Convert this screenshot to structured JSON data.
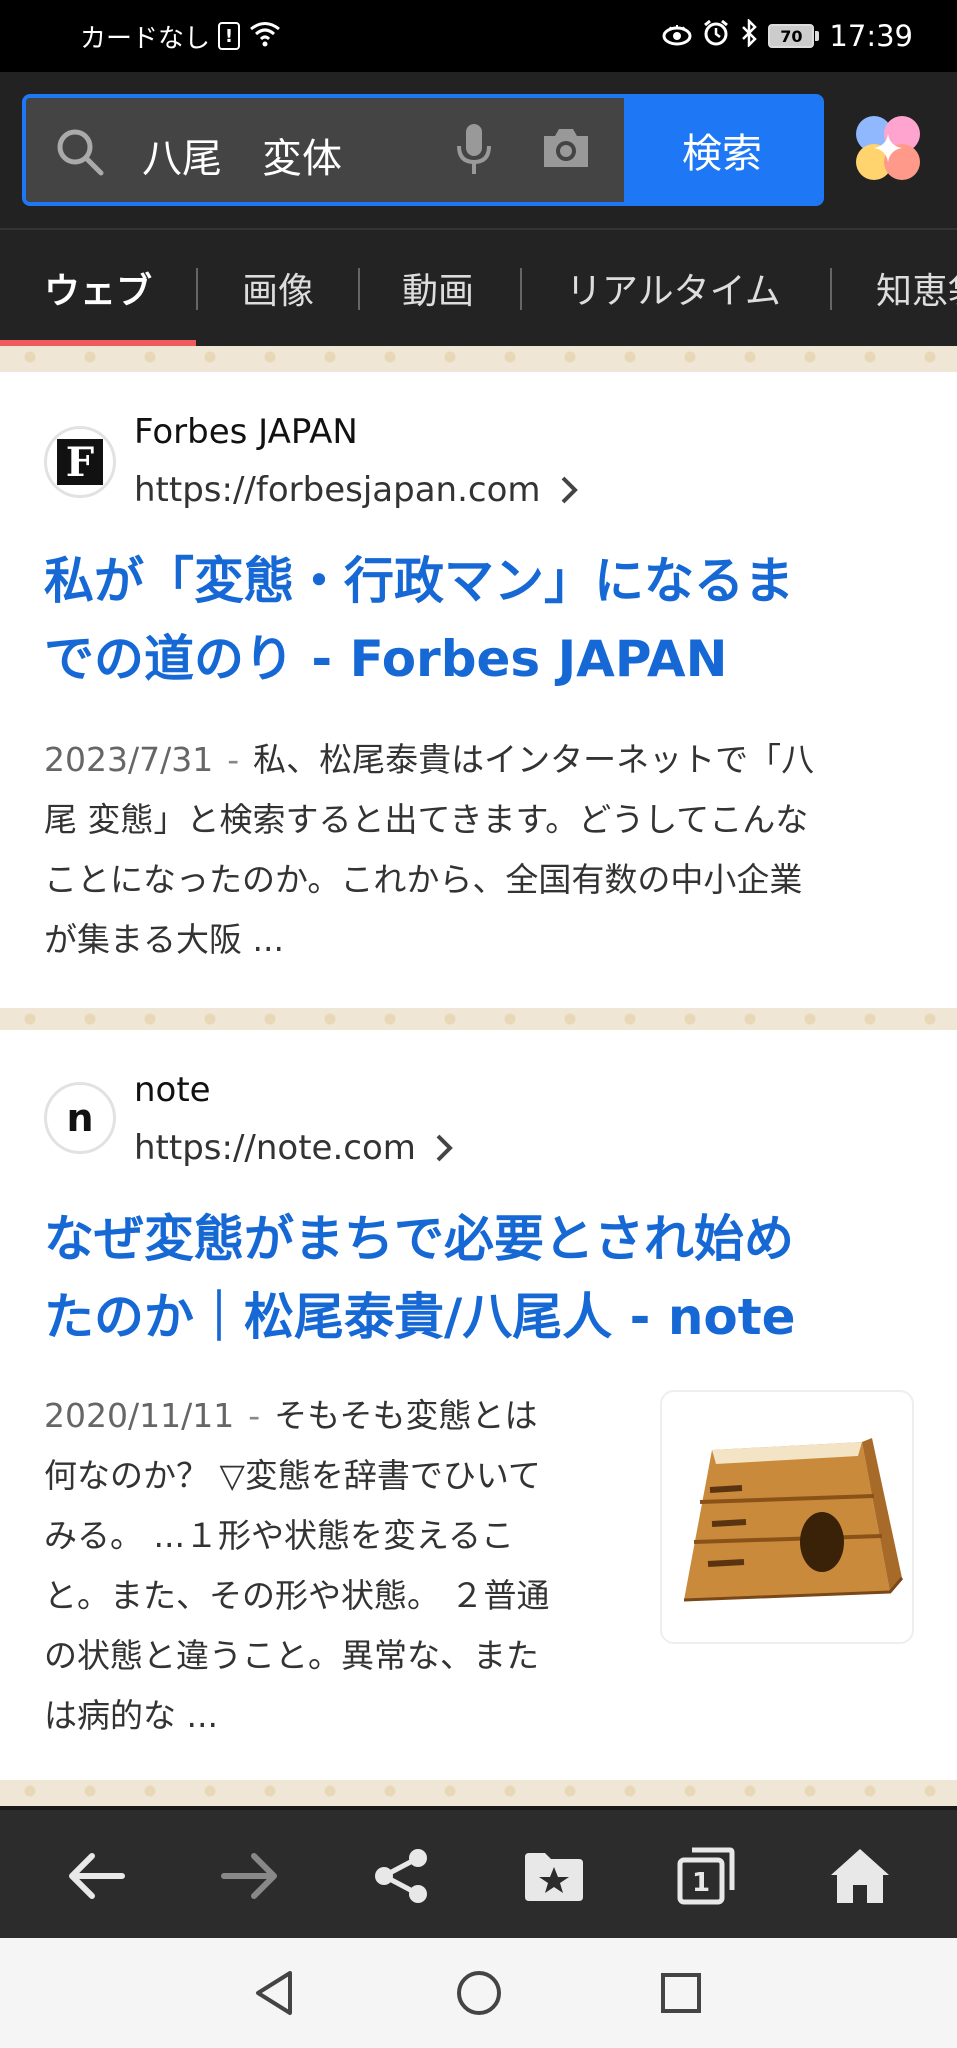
{
  "status_bar": {
    "carrier": "カードなし",
    "sim_alert": "!",
    "battery": "70",
    "time": "17:39"
  },
  "search": {
    "query": "八尾　変体",
    "button_label": "検索"
  },
  "tabs": [
    {
      "label": "ウェブ",
      "active": true
    },
    {
      "label": "画像",
      "active": false
    },
    {
      "label": "動画",
      "active": false
    },
    {
      "label": "リアルタイム",
      "active": false
    },
    {
      "label": "知恵袋",
      "active": false
    }
  ],
  "results": [
    {
      "site_name": "Forbes JAPAN",
      "favicon_letter": "F",
      "url": "https://forbesjapan.com",
      "title_line1": "私が「変態・行政マン」になるま",
      "title_line2": "での道のり - Forbes JAPAN",
      "date": "2023/7/31",
      "snippet_lines": [
        "私、松尾泰貴はインターネットで「八",
        "尾 変態」と検索すると出てきます。どうしてこんな",
        "ことになったのか。これから、全国有数の中小企業",
        "が集まる大阪 ..."
      ]
    },
    {
      "site_name": "note",
      "favicon_letter": "n",
      "url": "https://note.com",
      "title_line1": "なぜ変態がまちで必要とされ始め",
      "title_line2": "たのか｜松尾泰貴/八尾人 - note",
      "date": "2020/11/11",
      "snippet_lines": [
        "そもそも変態とは",
        "何なのか？ ▽変態を辞書でひいて",
        "みる。 ...１形や状態を変えるこ",
        "と。また、その形や状態。 ２普通",
        "の状態と違うこと。異常な、また",
        "は病的な ..."
      ]
    }
  ],
  "toolbar": {
    "tabs_count": "1"
  },
  "colors": {
    "accent_blue": "#1e78f5",
    "link_blue": "#1668d5",
    "tab_underline": "#ef5a5f"
  }
}
